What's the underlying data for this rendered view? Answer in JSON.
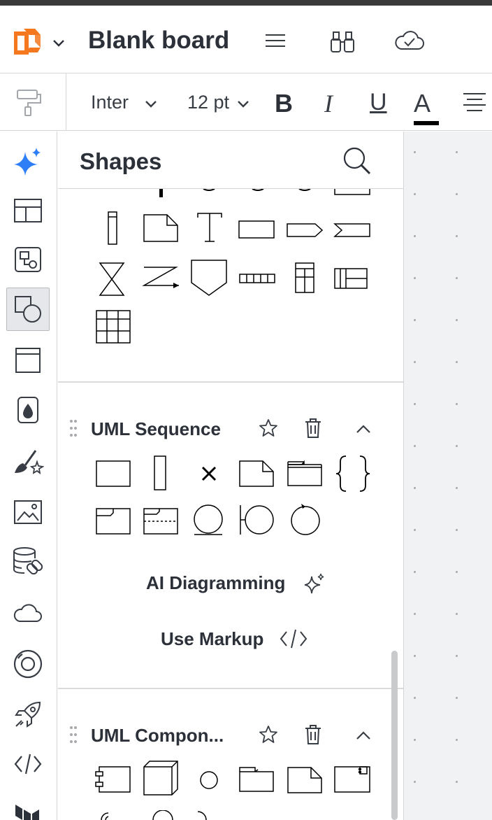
{
  "header": {
    "title": "Blank board",
    "logo_icon": "lucid-logo-icon",
    "menu_icon": "hamburger-menu-icon",
    "find_icon": "binoculars-icon",
    "save_icon": "cloud-check-icon"
  },
  "toolbar": {
    "font_family": "Inter",
    "font_size": "12 pt",
    "bold_label": "B",
    "italic_label": "I",
    "underline_label": "U",
    "text_color_label": "A",
    "text_color": "#000000"
  },
  "rail": {
    "items": [
      "ai-sparkle-icon",
      "templates-icon",
      "diagram-icon",
      "shapes-icon",
      "frame-icon",
      "color-fill-icon",
      "brush-icon",
      "image-icon",
      "data-linking-icon",
      "cloud-icon",
      "integration-icon",
      "rocket-icon",
      "code-icon",
      "terraform-icon"
    ],
    "active": "shapes-icon"
  },
  "panel": {
    "title": "Shapes",
    "search_icon": "search-icon",
    "sections": [
      {
        "title": "UML Sequence"
      },
      {
        "title": "UML Compon..."
      }
    ],
    "ai_diagramming": "AI Diagramming",
    "use_markup": "Use Markup"
  },
  "colors": {
    "accent_blue": "#2d7ef7",
    "logo_orange": "#f5781f",
    "text_dark": "#2c3039",
    "canvas_bg": "#f1f2f4"
  }
}
